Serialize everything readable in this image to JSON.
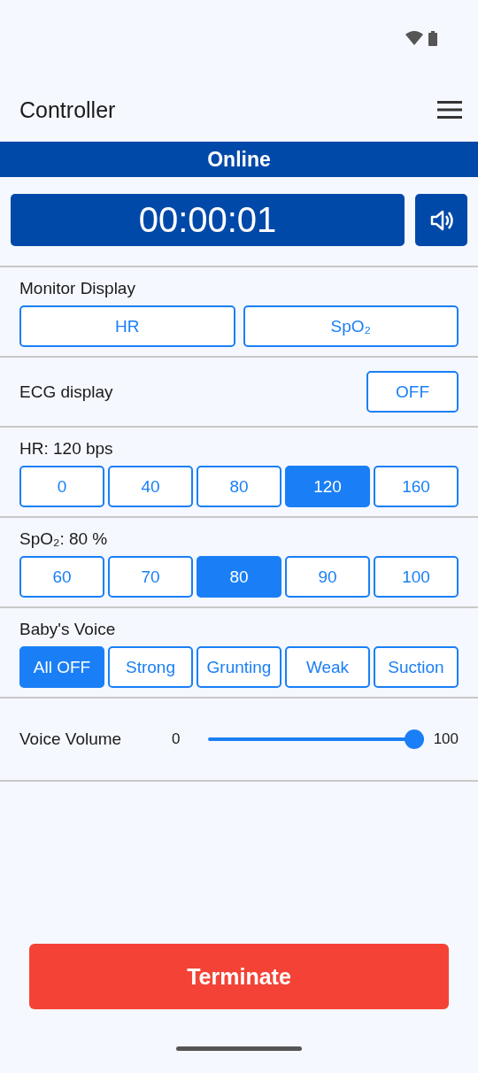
{
  "app_bar": {
    "title": "Controller"
  },
  "status": {
    "label": "Online"
  },
  "timer": {
    "value": "00:00:01"
  },
  "monitor_display": {
    "label": "Monitor Display",
    "options": [
      {
        "label": "HR",
        "selected": false
      },
      {
        "label": "SpO₂",
        "selected": false
      }
    ]
  },
  "ecg_display": {
    "label": "ECG display",
    "button": "OFF"
  },
  "hr": {
    "label": "HR: 120 bps",
    "options": [
      {
        "label": "0",
        "selected": false
      },
      {
        "label": "40",
        "selected": false
      },
      {
        "label": "80",
        "selected": false
      },
      {
        "label": "120",
        "selected": true
      },
      {
        "label": "160",
        "selected": false
      }
    ]
  },
  "spo2": {
    "label": "SpO₂: 80 %",
    "options": [
      {
        "label": "60",
        "selected": false
      },
      {
        "label": "70",
        "selected": false
      },
      {
        "label": "80",
        "selected": true
      },
      {
        "label": "90",
        "selected": false
      },
      {
        "label": "100",
        "selected": false
      }
    ]
  },
  "babys_voice": {
    "label": "Baby's Voice",
    "options": [
      {
        "label": "All OFF",
        "selected": true
      },
      {
        "label": "Strong",
        "selected": false
      },
      {
        "label": "Grunting",
        "selected": false
      },
      {
        "label": "Weak",
        "selected": false
      },
      {
        "label": "Suction",
        "selected": false
      }
    ]
  },
  "voice_volume": {
    "label": "Voice Volume",
    "min": "0",
    "max": "100",
    "level": 1
  },
  "terminate_button": "Terminate"
}
